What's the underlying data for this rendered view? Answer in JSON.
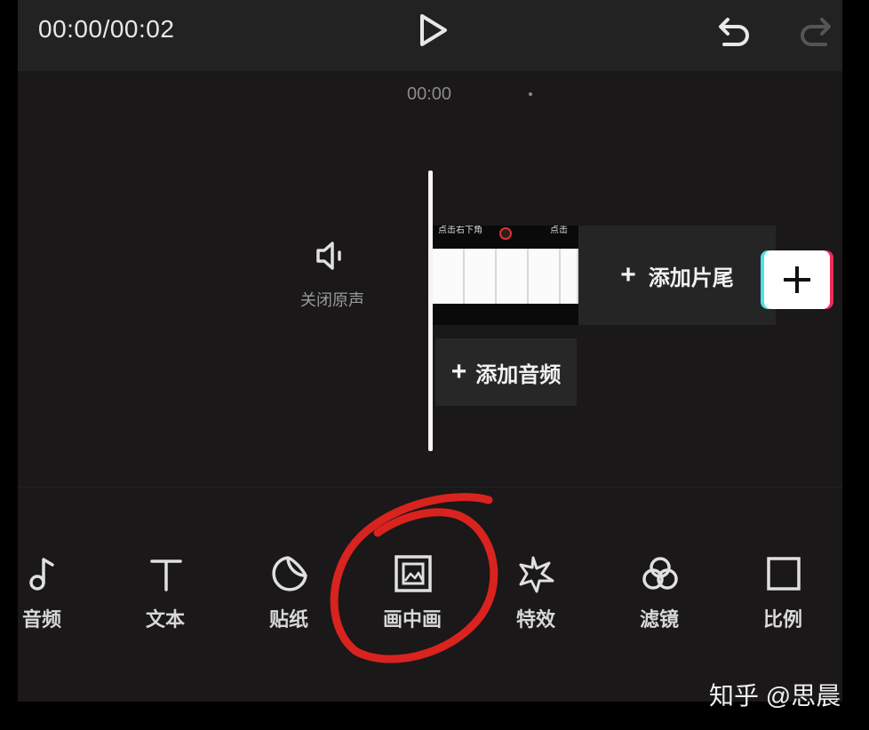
{
  "header": {
    "time_readout": "00:00/00:02"
  },
  "timeline": {
    "ruler_time": "00:00",
    "mute_label": "关闭原声",
    "clip_text_1": "点击右下角",
    "clip_text_2": "点击",
    "add_ending_label": "添加片尾",
    "add_audio_label": "添加音频",
    "plus_glyph": "+"
  },
  "toolbar": {
    "items": [
      {
        "label": "音频",
        "icon": "music-note-icon"
      },
      {
        "label": "文本",
        "icon": "text-icon"
      },
      {
        "label": "贴纸",
        "icon": "sticker-icon"
      },
      {
        "label": "画中画",
        "icon": "picture-in-picture-icon"
      },
      {
        "label": "特效",
        "icon": "effects-star-icon"
      },
      {
        "label": "滤镜",
        "icon": "filter-icon"
      },
      {
        "label": "比例",
        "icon": "ratio-icon"
      }
    ]
  },
  "annotation": {
    "color": "#d8231f"
  },
  "watermark": "知乎 @思晨"
}
